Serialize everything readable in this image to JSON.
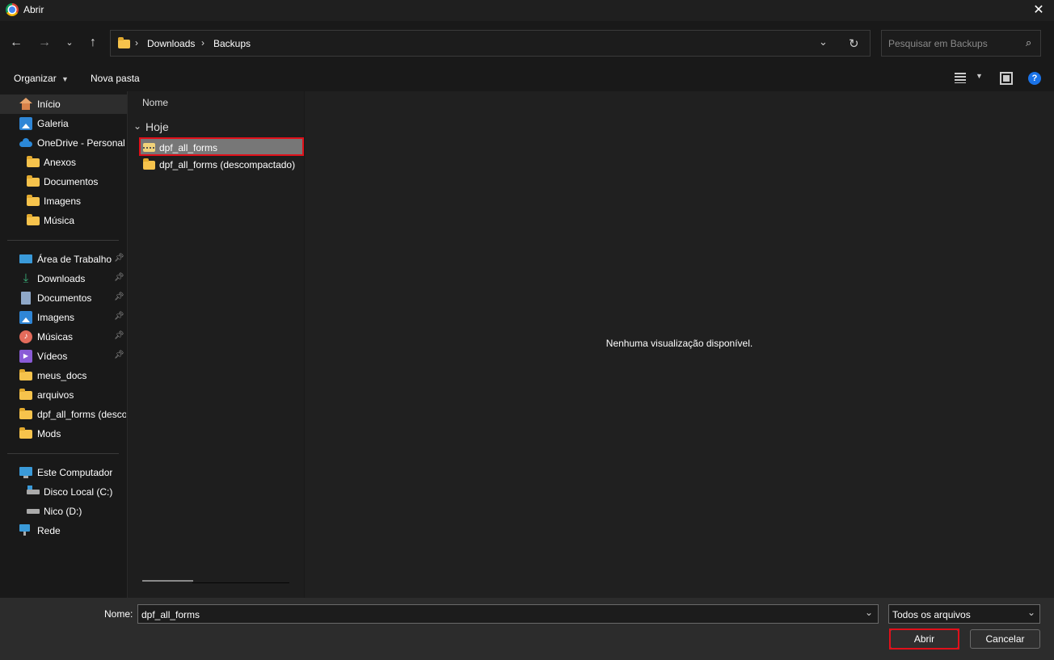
{
  "window": {
    "title": "Abrir"
  },
  "address": {
    "crumbs": [
      "Downloads",
      "Backups"
    ]
  },
  "search": {
    "placeholder": "Pesquisar em Backups"
  },
  "toolbar": {
    "organize": "Organizar",
    "new_folder": "Nova pasta"
  },
  "sidebar": {
    "top": [
      {
        "label": "Início",
        "icon": "home-icon"
      },
      {
        "label": "Galeria",
        "icon": "gallery-icon"
      },
      {
        "label": "OneDrive - Personal",
        "icon": "cloud-icon"
      },
      {
        "label": "Anexos",
        "icon": "folder-icon"
      },
      {
        "label": "Documentos",
        "icon": "folder-icon"
      },
      {
        "label": "Imagens",
        "icon": "folder-icon"
      },
      {
        "label": "Música",
        "icon": "folder-icon"
      }
    ],
    "quick": [
      {
        "label": "Área de Trabalho",
        "icon": "desktop-icon",
        "pinned": true
      },
      {
        "label": "Downloads",
        "icon": "download-icon",
        "pinned": true
      },
      {
        "label": "Documentos",
        "icon": "document-icon",
        "pinned": true
      },
      {
        "label": "Imagens",
        "icon": "image-icon",
        "pinned": true
      },
      {
        "label": "Músicas",
        "icon": "music-icon",
        "pinned": true
      },
      {
        "label": "Vídeos",
        "icon": "video-icon",
        "pinned": true
      },
      {
        "label": "meus_docs",
        "icon": "folder-icon"
      },
      {
        "label": "arquivos",
        "icon": "folder-icon"
      },
      {
        "label": "dpf_all_forms (desco",
        "icon": "folder-icon"
      },
      {
        "label": "Mods",
        "icon": "folder-icon"
      }
    ],
    "devices": [
      {
        "label": "Este Computador",
        "icon": "computer-icon"
      },
      {
        "label": "Disco Local (C:)",
        "icon": "drive-icon"
      },
      {
        "label": "Nico (D:)",
        "icon": "drive-icon"
      },
      {
        "label": "Rede",
        "icon": "network-icon"
      }
    ]
  },
  "filelist": {
    "column_name": "Nome",
    "group": "Hoje",
    "files": [
      {
        "name": "dpf_all_forms",
        "icon": "zip-folder-icon",
        "selected": true
      },
      {
        "name": "dpf_all_forms (descompactado)",
        "icon": "folder-icon",
        "selected": false
      }
    ]
  },
  "preview": {
    "message": "Nenhuma visualização disponível."
  },
  "bottom": {
    "name_label": "Nome:",
    "name_value": "dpf_all_forms",
    "filter_value": "Todos os arquivos",
    "open_label": "Abrir",
    "cancel_label": "Cancelar"
  },
  "colors": {
    "highlight": "#e0101a",
    "selection": "#777777"
  }
}
